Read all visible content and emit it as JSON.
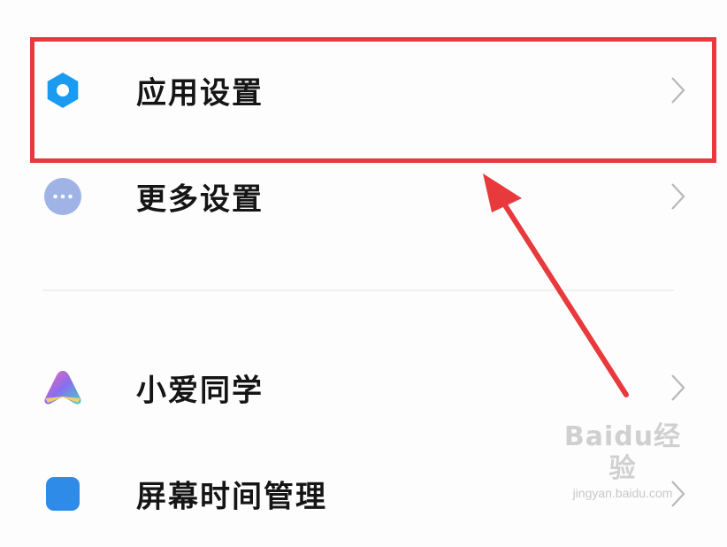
{
  "settings": {
    "items": [
      {
        "label": "应用设置",
        "icon": "gear-icon",
        "icon_color": "#1a9bf0"
      },
      {
        "label": "更多设置",
        "icon": "more-dots-icon",
        "icon_color": "#9fb3e6"
      },
      {
        "label": "小爱同学",
        "icon": "xiaoai-assistant-icon"
      },
      {
        "label": "屏幕时间管理",
        "icon": "screen-time-icon",
        "icon_color": "#2e8be8"
      }
    ]
  },
  "annotation": {
    "highlight_color": "#e8393c"
  },
  "watermark": {
    "main": "Baidu经验",
    "sub": "jingyan.baidu.com"
  }
}
